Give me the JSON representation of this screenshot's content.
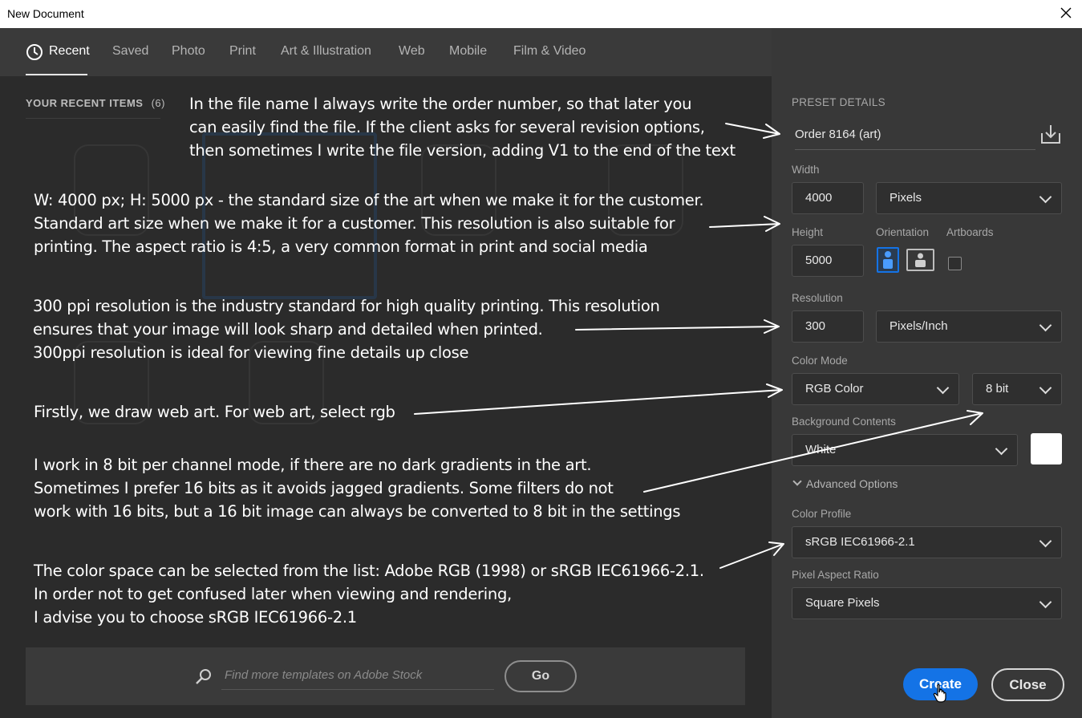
{
  "window": {
    "title": "New Document"
  },
  "tabs": [
    {
      "label": "Recent",
      "active": true
    },
    {
      "label": "Saved"
    },
    {
      "label": "Photo"
    },
    {
      "label": "Print"
    },
    {
      "label": "Art & Illustration"
    },
    {
      "label": "Web"
    },
    {
      "label": "Mobile"
    },
    {
      "label": "Film & Video"
    }
  ],
  "recent": {
    "label": "YOUR RECENT ITEMS",
    "count": "(6)"
  },
  "annotations": {
    "filename": "In the file name I always write the order number, so that later you\ncan easily find the file. If the client asks for several revision options,\nthen sometimes I write the file version, adding V1 to the end of the text",
    "size": "W: 4000 px; H: 5000 px - the standard size of the art when we make it for the customer.\nStandard art size when we make it for a customer. This resolution is also suitable for\nprinting. The aspect ratio is 4:5, a very common format in print and social media",
    "resolution": "300 ppi resolution is the industry standard for high quality printing. This resolution\nensures that your image will look sharp and detailed when printed.\n300ppi resolution is ideal for viewing fine details up close",
    "colormode": "Firstly, we draw web art. For web art, select rgb",
    "bitdepth": "I work in 8 bit per channel mode, if there are no dark gradients in the art.\nSometimes I prefer 16 bits as it avoids jagged gradients. Some filters do not\nwork with 16 bits, but a 16 bit image can always be converted to 8 bit in the settings",
    "colorspace": "The color space can be selected from the list: Adobe RGB (1998) or sRGB IEC61966-2.1.\nIn order not to get confused later when viewing and rendering,\nI advise you to choose sRGB IEC61966-2.1"
  },
  "stock": {
    "placeholder": "Find more templates on Adobe Stock",
    "go_label": "Go"
  },
  "preset": {
    "header": "PRESET DETAILS",
    "name": "Order 8164 (art)",
    "width_label": "Width",
    "width_value": "4000",
    "width_unit": "Pixels",
    "height_label": "Height",
    "height_value": "5000",
    "orientation_label": "Orientation",
    "artboards_label": "Artboards",
    "resolution_label": "Resolution",
    "resolution_value": "300",
    "resolution_unit": "Pixels/Inch",
    "colormode_label": "Color Mode",
    "colormode_value": "RGB Color",
    "bitdepth_value": "8 bit",
    "background_label": "Background Contents",
    "background_value": "White",
    "advanced_label": "Advanced Options",
    "profile_label": "Color Profile",
    "profile_value": "sRGB IEC61966-2.1",
    "pixel_aspect_label": "Pixel Aspect Ratio",
    "pixel_aspect_value": "Square Pixels"
  },
  "buttons": {
    "create": "Create",
    "close": "Close"
  },
  "colors": {
    "accent": "#1473e6",
    "background_swatch": "#ffffff"
  }
}
